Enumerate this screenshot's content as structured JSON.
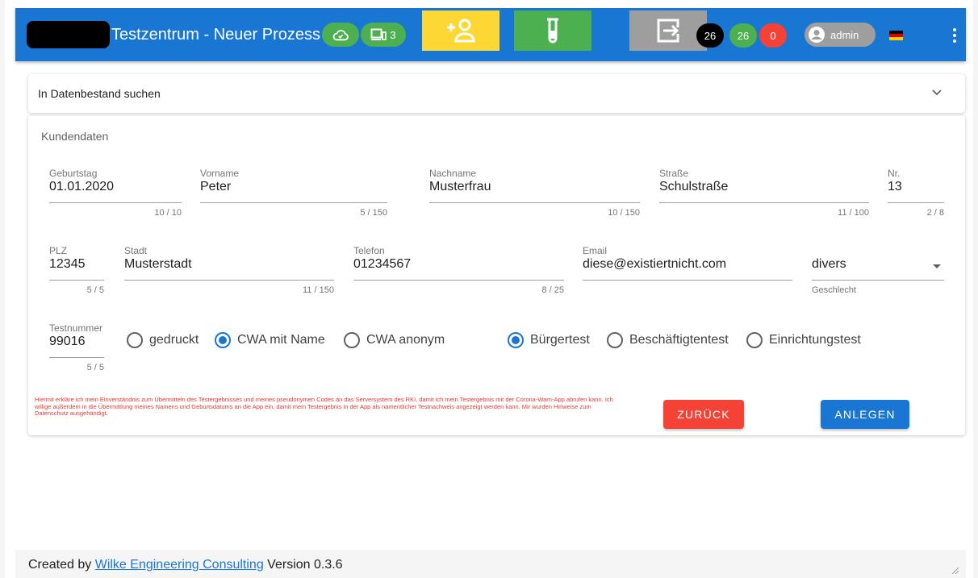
{
  "header": {
    "title": "Testzentrum - Neuer Prozess",
    "devices_count": "3",
    "counts": [
      "26",
      "26",
      "0"
    ],
    "user": "admin",
    "colors": {
      "bar": "#1976d2",
      "yellow": "#fdd835",
      "green": "#4caf50",
      "grey": "#9e9e9e",
      "red": "#f44336"
    },
    "icons": [
      "cloud-sync-icon",
      "devices-icon",
      "add-person-icon",
      "test-tube-icon",
      "logout-icon",
      "account-circle-icon",
      "german-flag-icon",
      "more-vert-icon"
    ]
  },
  "search": {
    "title": "In Datenbestand suchen"
  },
  "form": {
    "section_title": "Kundendaten",
    "fields": {
      "birthday": {
        "label": "Geburtstag",
        "value": "01.01.2020",
        "counter": "10 / 10"
      },
      "firstname": {
        "label": "Vorname",
        "value": "Peter",
        "counter": "5 / 150"
      },
      "lastname": {
        "label": "Nachname",
        "value": "Musterfrau",
        "counter": "10 / 150"
      },
      "street": {
        "label": "Straße",
        "value": "Schulstraße",
        "counter": "11 / 100"
      },
      "number": {
        "label": "Nr.",
        "value": "13",
        "counter": "2 / 8"
      },
      "zip": {
        "label": "PLZ",
        "value": "12345",
        "counter": "5 / 5"
      },
      "city": {
        "label": "Stadt",
        "value": "Musterstadt",
        "counter": "11 / 150"
      },
      "phone": {
        "label": "Telefon",
        "value": "01234567",
        "counter": "8 / 25"
      },
      "email": {
        "label": "Email",
        "value": "diese@existiertnicht.com"
      },
      "gender": {
        "value": "divers",
        "hint": "Geschlecht"
      },
      "testnumber": {
        "label": "Testnummer",
        "value": "99016",
        "counter": "5 / 5"
      }
    },
    "result_mode": [
      "gedruckt",
      "CWA mit Name",
      "CWA anonym"
    ],
    "result_mode_selected": "CWA mit Name",
    "test_type": [
      "Bürgertest",
      "Beschäftigtentest",
      "Einrichtungstest"
    ],
    "test_type_selected": "Bürgertest",
    "consent": "Hiermit erkläre ich mein Einverständnis zum Übermitteln des Testergebnisses und meines pseudonymen Codes an das Serversystem des RKI, damit ich mein Testergebnis mit der Corona-Warn-App abrufen kann. Ich willige außerdem in die Übermittlung meines Namens und Geburtsdatums an die App ein, damit mein Testergebnis in der App als namentlicher Testnachweis angezeigt werden kann. Mir wurden Hinweise zum Datenschutz ausgehändigt.",
    "back_label": "ZURÜCK",
    "create_label": "ANLEGEN"
  },
  "footer": {
    "prefix": "Created by",
    "link": "Wilke Engineering Consulting",
    "version": "Version 0.3.6"
  }
}
